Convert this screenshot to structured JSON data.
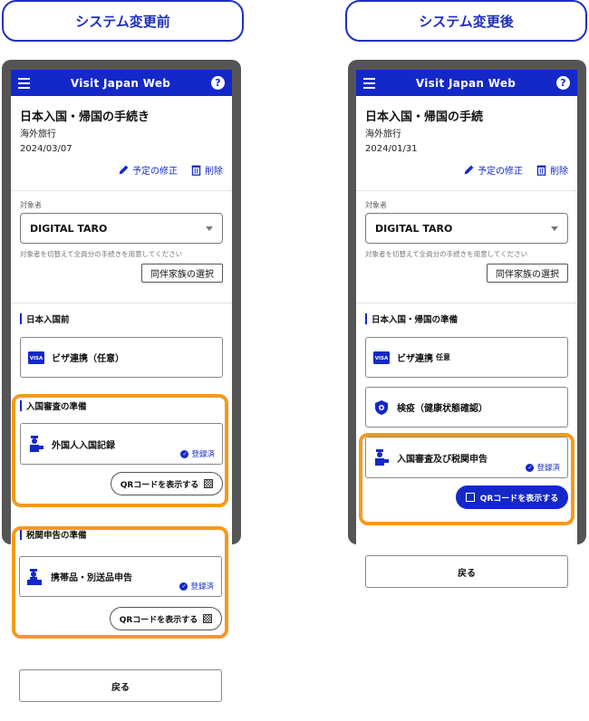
{
  "banners": {
    "before": "システム変更前",
    "after": "システム変更後"
  },
  "app": {
    "title": "Visit Japan Web",
    "help_glyph": "?"
  },
  "common": {
    "page_title": "日本入国・帰国の手続き",
    "page_title_after": "日本入国・帰国の手続",
    "trip_type": "海外旅行",
    "edit_label": "予定の修正",
    "delete_label": "削除",
    "target_label": "対象者",
    "target_value": "DIGITAL TARO",
    "helper_text": "対象者を切替えて全員分の手続きを用意してください",
    "companion_button": "同伴家族の選択",
    "registered_badge": "登録済",
    "qr_button": "QRコードを表示する",
    "back_button": "戻る"
  },
  "before": {
    "date": "2024/03/07",
    "section1_heading": "日本入国前",
    "visa_card": "ビザ連携（任意）",
    "immigration_heading": "入国審査の準備",
    "immigration_card": "外国人入国記録",
    "customs_heading": "税関申告の準備",
    "customs_card": "携帯品・別送品申告"
  },
  "after": {
    "date": "2024/01/31",
    "section1_heading": "日本入国・帰国の準備",
    "visa_card": "ビザ連携",
    "visa_optional": "任意",
    "quarantine_card": "検疫（健康状態確認）",
    "combined_card": "入国審査及び税関申告"
  },
  "colors": {
    "brand_blue": "#1428c8",
    "highlight_orange": "#f49a1c",
    "frame_gray": "#555555"
  },
  "icons": [
    "menu-icon",
    "help-icon",
    "pencil-icon",
    "trash-icon",
    "visa-icon",
    "officer-icon",
    "customs-officer-icon",
    "virus-shield-icon",
    "check-circle-icon",
    "qr-icon"
  ]
}
